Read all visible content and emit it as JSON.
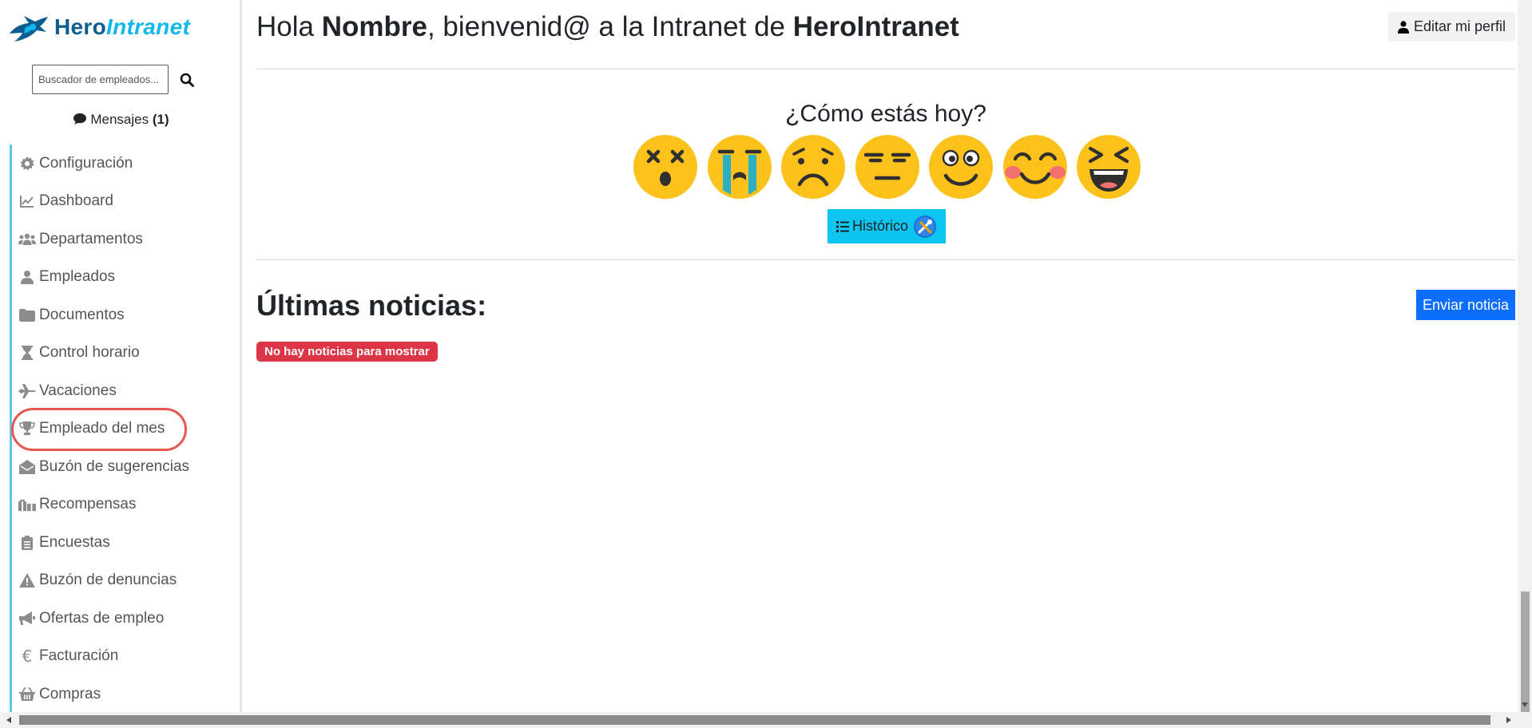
{
  "app": {
    "logo_hero": "Hero",
    "logo_intranet": "Intranet"
  },
  "sidebar": {
    "search_placeholder": "Buscador de empleados...",
    "messages_label": "Mensajes",
    "messages_count": "(1)",
    "accent_color": "#5fc8e8",
    "items": [
      {
        "label": "Configuración",
        "icon": "gear-icon"
      },
      {
        "label": "Dashboard",
        "icon": "chart-line-icon"
      },
      {
        "label": "Departamentos",
        "icon": "users-icon"
      },
      {
        "label": "Empleados",
        "icon": "user-icon"
      },
      {
        "label": "Documentos",
        "icon": "folder-icon"
      },
      {
        "label": "Control horario",
        "icon": "hourglass-icon"
      },
      {
        "label": "Vacaciones",
        "icon": "plane-icon"
      },
      {
        "label": "Empleado del mes",
        "icon": "trophy-icon"
      },
      {
        "label": "Buzón de sugerencias",
        "icon": "envelope-open-icon"
      },
      {
        "label": "Recompensas",
        "icon": "gifts-icon"
      },
      {
        "label": "Encuestas",
        "icon": "clipboard-list-icon"
      },
      {
        "label": "Buzón de denuncias",
        "icon": "warning-icon"
      },
      {
        "label": "Ofertas de empleo",
        "icon": "megaphone-icon"
      },
      {
        "label": "Facturación",
        "icon": "euro-icon"
      },
      {
        "label": "Compras",
        "icon": "basket-icon"
      }
    ]
  },
  "header": {
    "greeting_prefix": "Hola ",
    "user_name": "Nombre",
    "greeting_middle": ", bienvenid@ a la Intranet de ",
    "company_name": "HeroIntranet",
    "edit_profile_label": "Editar mi perfil"
  },
  "mood": {
    "question": "¿Cómo estás hoy?",
    "emojis": [
      "dizzy-face-icon",
      "crying-face-icon",
      "sad-face-icon",
      "neutral-face-icon",
      "smiling-face-icon",
      "blushing-face-icon",
      "laughing-face-icon"
    ],
    "history_button_label": "Histórico",
    "history_button_color": "#0dc5ef"
  },
  "news": {
    "title": "Últimas noticias:",
    "send_button_label": "Enviar noticia",
    "send_button_color": "#0d6efd",
    "empty_message": "No hay noticias para mostrar",
    "empty_badge_color": "#dc3545"
  }
}
